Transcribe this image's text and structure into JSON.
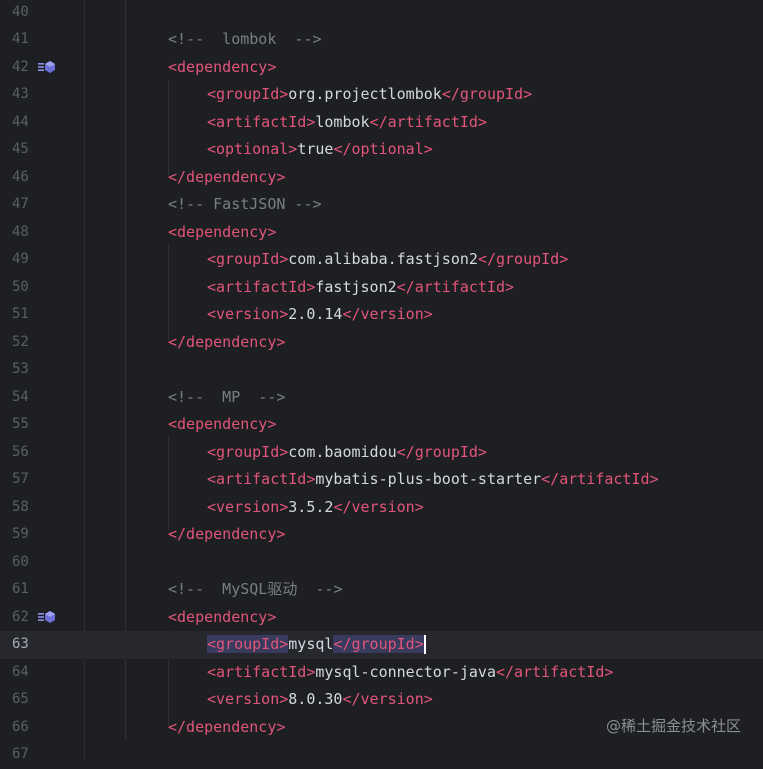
{
  "lines": [
    {
      "num": "40",
      "parts": []
    },
    {
      "num": "41",
      "parts": [
        {
          "t": "<!--  lombok  -->",
          "c": "cmt"
        }
      ]
    },
    {
      "num": "42",
      "icon": true,
      "parts": [
        {
          "t": "<dependency>",
          "c": "tag"
        }
      ]
    },
    {
      "num": "43",
      "parts": [
        {
          "t": "<groupId>",
          "c": "tag"
        },
        {
          "t": "org.projectlombok",
          "c": "txt"
        },
        {
          "t": "</groupId>",
          "c": "tag"
        }
      ]
    },
    {
      "num": "44",
      "parts": [
        {
          "t": "<artifactId>",
          "c": "tag"
        },
        {
          "t": "lombok",
          "c": "txt"
        },
        {
          "t": "</artifactId>",
          "c": "tag"
        }
      ]
    },
    {
      "num": "45",
      "parts": [
        {
          "t": "<optional>",
          "c": "tag"
        },
        {
          "t": "true",
          "c": "txt"
        },
        {
          "t": "</optional>",
          "c": "tag"
        }
      ]
    },
    {
      "num": "46",
      "parts": [
        {
          "t": "</dependency>",
          "c": "tag"
        }
      ]
    },
    {
      "num": "47",
      "parts": [
        {
          "t": "<!-- FastJSON -->",
          "c": "cmt"
        }
      ]
    },
    {
      "num": "48",
      "parts": [
        {
          "t": "<dependency>",
          "c": "tag"
        }
      ]
    },
    {
      "num": "49",
      "parts": [
        {
          "t": "<groupId>",
          "c": "tag"
        },
        {
          "t": "com.alibaba.fastjson2",
          "c": "txt"
        },
        {
          "t": "</groupId>",
          "c": "tag"
        }
      ]
    },
    {
      "num": "50",
      "parts": [
        {
          "t": "<artifactId>",
          "c": "tag"
        },
        {
          "t": "fastjson2",
          "c": "txt"
        },
        {
          "t": "</artifactId>",
          "c": "tag"
        }
      ]
    },
    {
      "num": "51",
      "parts": [
        {
          "t": "<version>",
          "c": "tag"
        },
        {
          "t": "2.0.14",
          "c": "txt"
        },
        {
          "t": "</version>",
          "c": "tag"
        }
      ]
    },
    {
      "num": "52",
      "parts": [
        {
          "t": "</dependency>",
          "c": "tag"
        }
      ]
    },
    {
      "num": "53",
      "parts": []
    },
    {
      "num": "54",
      "parts": [
        {
          "t": "<!--  MP  -->",
          "c": "cmt"
        }
      ]
    },
    {
      "num": "55",
      "parts": [
        {
          "t": "<dependency>",
          "c": "tag"
        }
      ]
    },
    {
      "num": "56",
      "parts": [
        {
          "t": "<groupId>",
          "c": "tag"
        },
        {
          "t": "com.baomidou",
          "c": "txt"
        },
        {
          "t": "</groupId>",
          "c": "tag"
        }
      ]
    },
    {
      "num": "57",
      "parts": [
        {
          "t": "<artifactId>",
          "c": "tag"
        },
        {
          "t": "mybatis-plus-boot-starter",
          "c": "txt"
        },
        {
          "t": "</artifactId>",
          "c": "tag"
        }
      ]
    },
    {
      "num": "58",
      "parts": [
        {
          "t": "<version>",
          "c": "tag"
        },
        {
          "t": "3.5.2",
          "c": "txt"
        },
        {
          "t": "</version>",
          "c": "tag"
        }
      ]
    },
    {
      "num": "59",
      "parts": [
        {
          "t": "</dependency>",
          "c": "tag"
        }
      ]
    },
    {
      "num": "60",
      "parts": []
    },
    {
      "num": "61",
      "parts": [
        {
          "t": "<!--  MySQL驱动  -->",
          "c": "cmt"
        }
      ]
    },
    {
      "num": "62",
      "icon": true,
      "parts": [
        {
          "t": "<dependency>",
          "c": "tag"
        }
      ]
    },
    {
      "num": "63",
      "current": true,
      "parts": [
        {
          "t": "<groupId>",
          "c": "tag match"
        },
        {
          "t": "mysql",
          "c": "txt"
        },
        {
          "t": "</groupId>",
          "c": "tag match"
        }
      ]
    },
    {
      "num": "64",
      "parts": [
        {
          "t": "<artifactId>",
          "c": "tag"
        },
        {
          "t": "mysql-connector-java",
          "c": "txt"
        },
        {
          "t": "</artifactId>",
          "c": "tag"
        }
      ]
    },
    {
      "num": "65",
      "parts": [
        {
          "t": "<version>",
          "c": "tag"
        },
        {
          "t": "8.0.30",
          "c": "txt"
        },
        {
          "t": "</version>",
          "c": "tag"
        }
      ]
    },
    {
      "num": "66",
      "parts": [
        {
          "t": "</dependency>",
          "c": "tag"
        }
      ]
    },
    {
      "num": "67",
      "parts": []
    }
  ],
  "gutter_icon": "dependency-module-icon",
  "watermark": "@稀土掘金技术社区",
  "colors": {
    "background": "#1e1f22",
    "tag": "#e2557a",
    "text": "#d5d8de",
    "comment": "#7a7e85"
  }
}
